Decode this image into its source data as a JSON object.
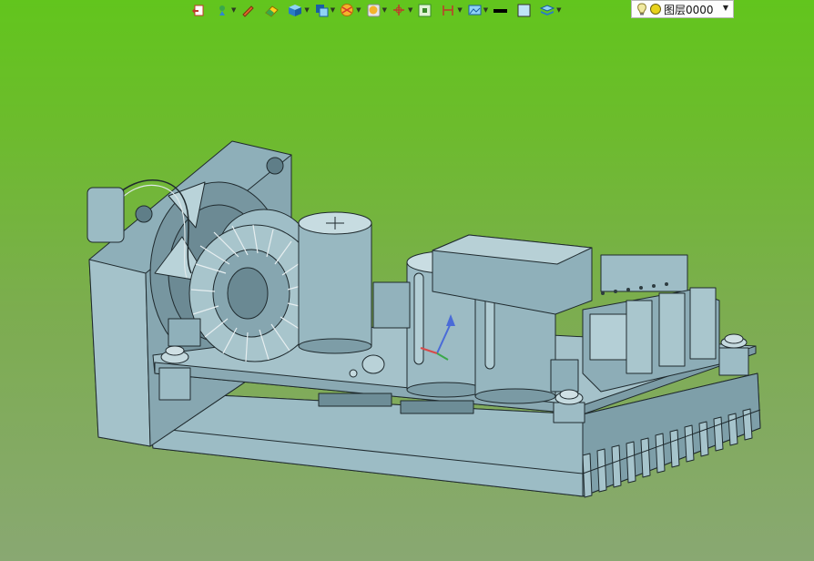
{
  "toolbar": {
    "buttons": [
      {
        "icon": "exit-sketch-icon",
        "dropdown": false
      },
      {
        "icon": "sketch-tool-icon",
        "dropdown": true
      },
      {
        "icon": "pen-icon",
        "dropdown": false
      },
      {
        "icon": "eraser-icon",
        "dropdown": false
      },
      {
        "icon": "solid-cube-icon",
        "dropdown": true
      },
      {
        "icon": "view-orientation-icon",
        "dropdown": true
      },
      {
        "icon": "section-view-icon",
        "dropdown": true
      },
      {
        "icon": "render-mode-icon",
        "dropdown": true
      },
      {
        "icon": "coordinate-axes-icon",
        "dropdown": true
      },
      {
        "icon": "zoom-fit-icon",
        "dropdown": false
      },
      {
        "icon": "dimension-icon",
        "dropdown": true
      },
      {
        "icon": "scene-icon",
        "dropdown": true
      },
      {
        "icon": "line-color-icon",
        "dropdown": false
      },
      {
        "icon": "fill-color-icon",
        "dropdown": false
      },
      {
        "icon": "layer-stack-icon",
        "dropdown": true
      }
    ],
    "layer": {
      "value": "图层0000",
      "colors": {
        "bulb": "#f0e9a0",
        "dot": "#e8d21a"
      }
    }
  },
  "model": {
    "body_color": "#8fb0ba",
    "edge_color": "#1f2a2e",
    "parts": [
      "cooling-fan",
      "toroidal-inductor",
      "electrolytic-capacitor",
      "electrolytic-capacitor",
      "electrolytic-capacitor",
      "transformer",
      "terminal-block",
      "heat-sink",
      "circuit-board"
    ]
  }
}
